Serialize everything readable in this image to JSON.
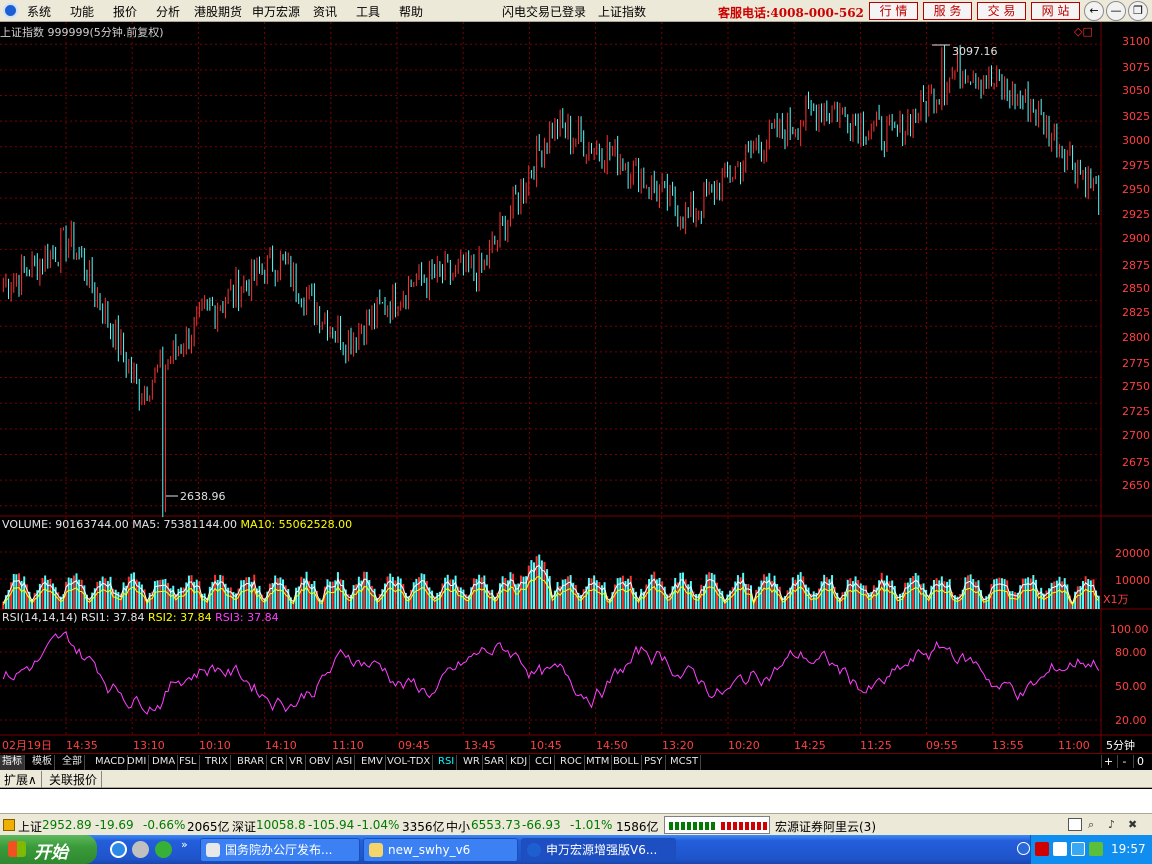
{
  "menubar": {
    "items": [
      "系统",
      "功能",
      "报价",
      "分析",
      "港股期货",
      "申万宏源",
      "资讯",
      "工具",
      "帮助"
    ],
    "login_status": "闪电交易已登录",
    "index_name": "上证指数",
    "hotline": "客服电话:4008-000-562",
    "quick_buttons": [
      "行 情",
      "服 务",
      "交 易",
      "网 站"
    ]
  },
  "chart": {
    "indicator_line": "上证指数 999999(5分钟.前复权)",
    "high_label": "3097.16",
    "low_label": "2638.96",
    "price_ticks": [
      "3100",
      "3075",
      "3050",
      "3025",
      "3000",
      "2975",
      "2950",
      "2925",
      "2900",
      "2875",
      "2850",
      "2825",
      "2800",
      "2775",
      "2750",
      "2725",
      "2700",
      "2675",
      "2650"
    ],
    "volume_label": {
      "volume": "VOLUME: 90163744.00",
      "ma5": "MA5: 75381144.00",
      "ma10": "MA10: 55062528.00"
    },
    "volume_ticks": [
      "20000",
      "10000"
    ],
    "volume_unit": "X1万",
    "rsi_label": {
      "name": "RSI(14,14,14)",
      "rsi1": "RSI1: 37.84",
      "rsi2": "RSI2: 37.84",
      "rsi3": "RSI3: 37.84"
    },
    "rsi_ticks": [
      "100.00",
      "80.00",
      "50.00",
      "20.00"
    ],
    "time_axis": [
      "02月19日",
      "14:35",
      "13:10",
      "10:10",
      "14:10",
      "11:10",
      "09:45",
      "13:45",
      "10:45",
      "14:50",
      "13:20",
      "10:20",
      "14:25",
      "11:25",
      "09:55",
      "13:55",
      "11:00"
    ],
    "period_label": "5分钟"
  },
  "chart_data": {
    "type": "candlestick",
    "title": "上证指数 999999(5分钟.前复权)",
    "x": [
      "02月19日",
      "14:35",
      "13:10",
      "10:10",
      "14:10",
      "11:10",
      "09:45",
      "13:45",
      "10:45",
      "14:50",
      "13:20",
      "10:20",
      "14:25",
      "11:25",
      "09:55",
      "13:55",
      "11:00"
    ],
    "ylim": [
      2640,
      3110
    ],
    "price_close_approx": [
      2865,
      2910,
      2760,
      2840,
      2890,
      2810,
      2870,
      2880,
      3020,
      2990,
      2930,
      3000,
      3040,
      3010,
      3080,
      3040,
      2955
    ],
    "high": 3097.16,
    "low": 2638.96,
    "volume": 90163744.0,
    "ma5": 75381144.0,
    "ma10": 55062528.0,
    "rsi": {
      "rsi1": 37.84,
      "rsi2": 37.84,
      "rsi3": 37.84,
      "ylim": [
        0,
        100
      ]
    }
  },
  "indicator_tabs": [
    "指标",
    "模板",
    "全部",
    "MACD",
    "DMI",
    "DMA",
    "FSL",
    "TRIX",
    "BRAR",
    "CR",
    "VR",
    "OBV",
    "ASI",
    "EMV",
    "VOL-TDX",
    "RSI",
    "WR",
    "SAR",
    "KDJ",
    "CCI",
    "ROC",
    "MTM",
    "BOLL",
    "PSY",
    "MCST"
  ],
  "tab_controls": [
    "+",
    "-",
    "0"
  ],
  "sub_tabs": [
    "扩展∧",
    "关联报价"
  ],
  "status": {
    "sh_name": "上证",
    "sh_value": "2952.89",
    "sh_change": "-19.69",
    "sh_pct": "-0.66%",
    "sh_amount": "2065亿",
    "sz_name": "深证",
    "sz_value": "10058.8",
    "sz_change": "-105.94",
    "sz_pct": "-1.04%",
    "sz_amount": "3356亿",
    "zx_name": "中小",
    "zx_value": "6553.73",
    "zx_change": "-66.93",
    "zx_pct": "-1.01%",
    "zx_amount": "1586亿",
    "broker": "宏源证券阿里云(3)"
  },
  "taskbar": {
    "start": "开始",
    "tasks": [
      "国务院办公厅发布...",
      "new_swhy_v6",
      "申万宏源增强版V6..."
    ],
    "time": "19:57"
  },
  "colors": {
    "up": "#ff3232",
    "down": "#54fcfc",
    "grid": "#7a0000",
    "rsi": "#ff40ff",
    "ma10": "#ffff00"
  }
}
